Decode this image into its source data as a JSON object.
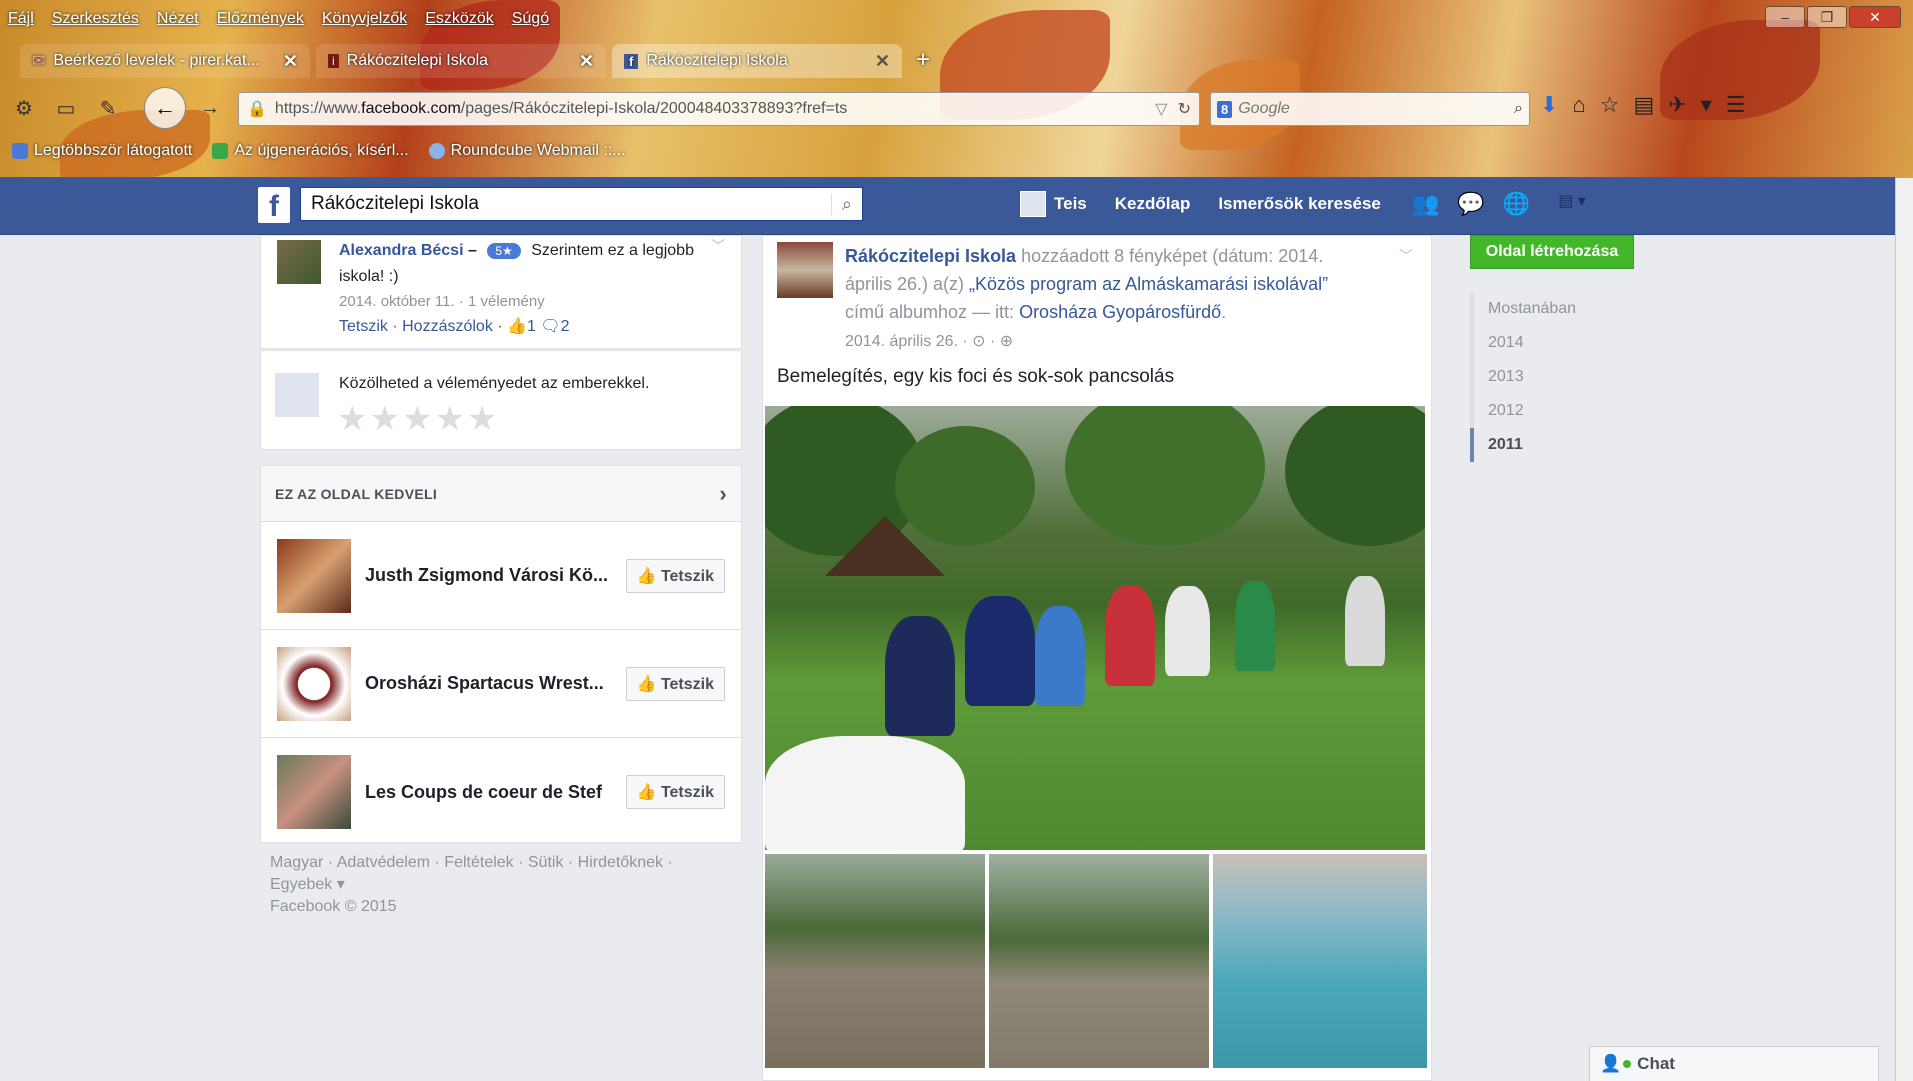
{
  "browser": {
    "menu": [
      "Fájl",
      "Szerkesztés",
      "Nézet",
      "Előzmények",
      "Könyvjelzők",
      "Eszközök",
      "Súgó"
    ],
    "tabs": [
      {
        "title": "Beérkező levelek - pirer.kat..."
      },
      {
        "title": "Rákóczitelepi Iskola"
      },
      {
        "title": "Rákóczitelepi Iskola"
      }
    ],
    "url_prefix": "https://www.",
    "url_domain": "facebook.com",
    "url_rest": "/pages/Rákóczitelepi-Iskola/200048403378893?fref=ts",
    "search_placeholder": "Google",
    "bookmarks": [
      "Legtöbbször látogatott",
      "Az újgenerációs, kísérl...",
      "Roundcube Webmail ::..."
    ]
  },
  "fb": {
    "search_value": "Rákóczitelepi Iskola",
    "nav": {
      "user": "Teis",
      "home": "Kezdőlap",
      "find_friends": "Ismerősök keresése"
    }
  },
  "review": {
    "name": "Alexandra Bécsi",
    "dash": "–",
    "badge": "5★",
    "text": "Szerintem ez a legjobb iskola! :)",
    "meta": "2014. október 11. · 1 vélemény",
    "like": "Tetszik",
    "comment": "Hozzászólok",
    "likes_count": "1",
    "comments_count": "2"
  },
  "share": {
    "text": "Közölheted a véleményedet az emberekkel.",
    "stars": "★★★★★"
  },
  "liked_pages": {
    "heading": "EZ AZ OLDAL KEDVELI",
    "button": "Tetszik",
    "items": [
      {
        "name": "Justh Zsigmond Városi Kö..."
      },
      {
        "name": "Orosházi Spartacus Wrest..."
      },
      {
        "name": "Les Coups de coeur de Stef"
      }
    ]
  },
  "footer": {
    "line1": "Magyar · Adatvédelem · Feltételek · Sütik · Hirdetőknek ·",
    "line2": "Egyebek ▾",
    "line3": "Facebook © 2015"
  },
  "post": {
    "page_name": "Rákóczitelepi Iskola",
    "action": " hozzáadott 8 fényképet (dátum: 2014. április 26.) a(z) ",
    "album": "„Közös program az Almáskamarási iskolával”",
    "album_suffix": " című albumhoz — itt: ",
    "place": "Orosháza Gyopárosfürdő",
    "place_suffix": ".",
    "date": "2014. április 26. · ⊙ · ⊕",
    "text": "Bemelegítés, egy kis foci és sok-sok pancsolás"
  },
  "right": {
    "create_page": "Oldal létrehozása",
    "timeline": [
      "Mostanában",
      "2014",
      "2013",
      "2012",
      "2011"
    ],
    "timeline_selected": "2011"
  },
  "chat": {
    "label": "Chat"
  },
  "colors": {
    "fb_blue": "#3b5998",
    "link": "#365899",
    "green": "#42b72a"
  }
}
